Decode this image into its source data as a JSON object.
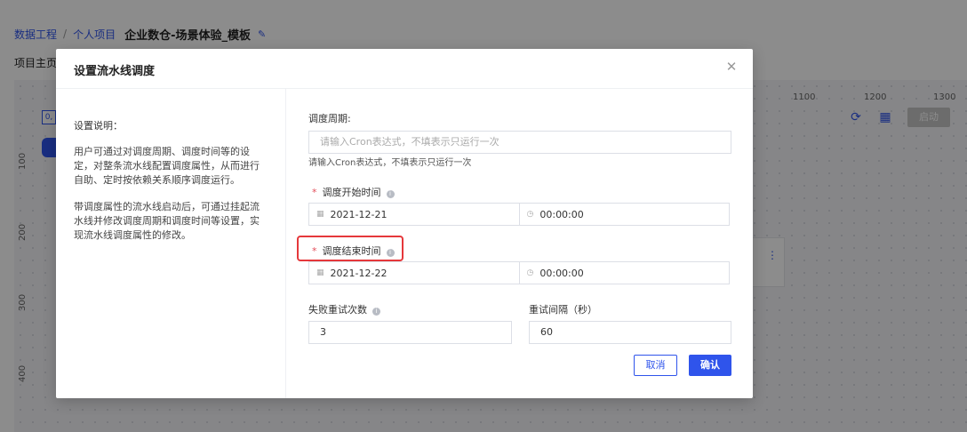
{
  "breadcrumb": {
    "root": "数据工程",
    "sep": "/",
    "project": "个人项目",
    "current": "企业数仓-场景体验_模板",
    "edit_icon": "edit-icon"
  },
  "tabs": {
    "home": "项目主页"
  },
  "canvas": {
    "ruler_x": [
      "1100",
      "1200",
      "1300"
    ],
    "ruler_y": [
      "100",
      "200",
      "300",
      "400"
    ],
    "start_label": "启动",
    "chip_label": "0,"
  },
  "modal": {
    "title": "设置流水线调度",
    "close_icon": "close-icon",
    "description": {
      "title": "设置说明：",
      "p1": "用户可通过对调度周期、调度时间等的设定，对整条流水线配置调度属性，从而进行自助、定时按依赖关系顺序调度运行。",
      "p2": "带调度属性的流水线启动后，可通过挂起流水线并修改调度周期和调度时间等设置，实现流水线调度属性的修改。"
    },
    "form": {
      "cycle_label": "调度周期:",
      "cycle_placeholder": "请输入Cron表达式，不填表示只运行一次",
      "cycle_hint": "请输入Cron表达式，不填表示只运行一次",
      "start_label": "调度开始时间",
      "start_date": "2021-12-21",
      "start_time": "00:00:00",
      "end_label": "调度结束时间",
      "end_date": "2021-12-22",
      "end_time": "00:00:00",
      "retry_count_label": "失败重试次数",
      "retry_count_value": "3",
      "retry_interval_label": "重试间隔（秒）",
      "retry_interval_value": "60",
      "required_mark": "*",
      "info_mark": "i"
    },
    "buttons": {
      "cancel": "取消",
      "ok": "确认"
    }
  },
  "colors": {
    "primary": "#2f54eb",
    "required": "#e34d59",
    "highlight": "#e5383b"
  }
}
